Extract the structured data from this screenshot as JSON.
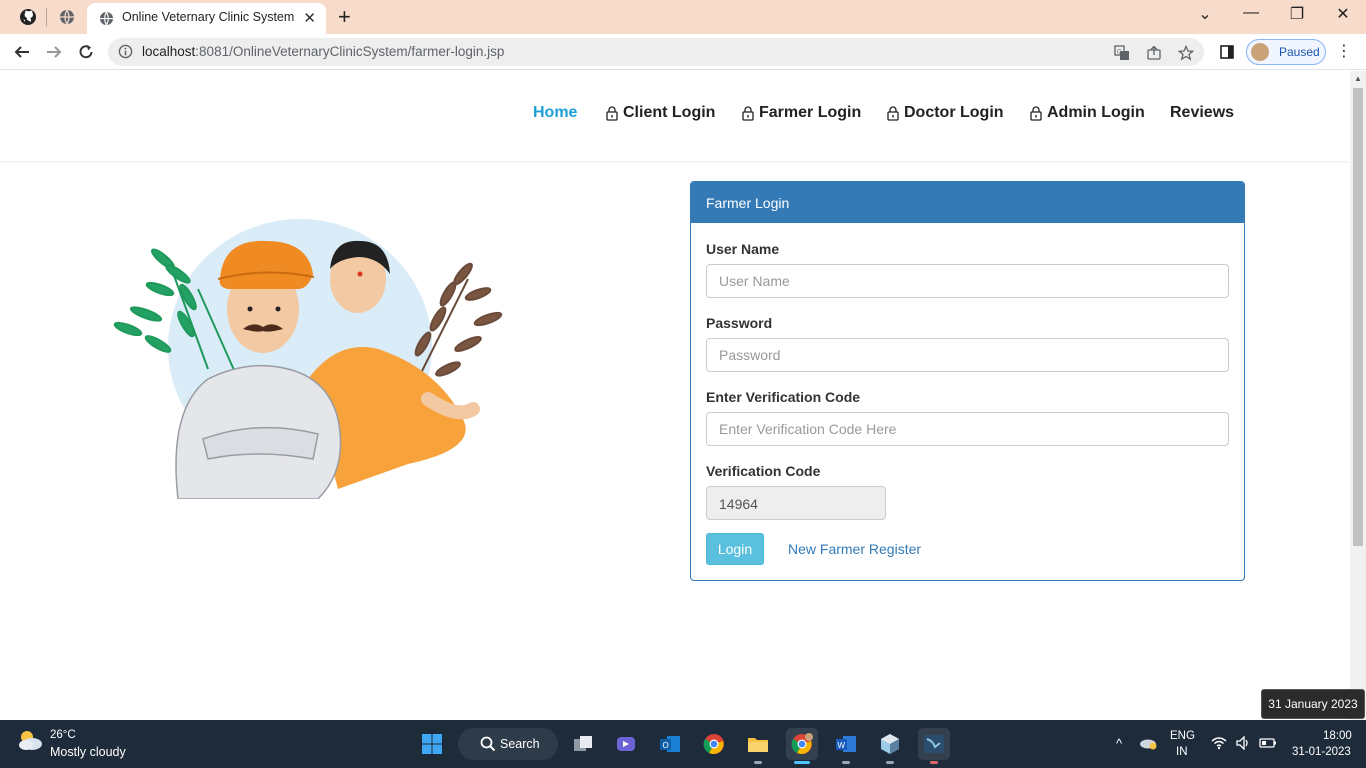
{
  "browser": {
    "tab_title": "Online Veternary Clinic System",
    "url_host": "localhost",
    "url_path": ":8081/OnlineVeternaryClinicSystem/farmer-login.jsp",
    "profile_status": "Paused"
  },
  "nav": {
    "home": "Home",
    "client_login": "Client Login",
    "farmer_login": "Farmer Login",
    "doctor_login": "Doctor Login",
    "admin_login": "Admin Login",
    "reviews": "Reviews"
  },
  "login_panel": {
    "title": "Farmer Login",
    "username_label": "User Name",
    "username_placeholder": "User Name",
    "password_label": "Password",
    "password_placeholder": "Password",
    "verify_label": "Enter Verification Code",
    "verify_placeholder": "Enter Verification Code Here",
    "code_label": "Verification Code",
    "code_value": "14964",
    "login_button": "Login",
    "register_link": "New Farmer Register"
  },
  "colors": {
    "primary": "#337ab7",
    "nav_active": "#1e9fd6",
    "login_button": "#5bc0de",
    "tab_strip": "#f7dccb",
    "taskbar": "#1d2b3a"
  },
  "taskbar": {
    "weather_temp": "26°C",
    "weather_cond": "Mostly cloudy",
    "search_label": "Search",
    "lang_line1": "ENG",
    "lang_line2": "IN",
    "time": "18:00",
    "date": "31-01-2023",
    "date_tooltip": "31 January 2023"
  }
}
